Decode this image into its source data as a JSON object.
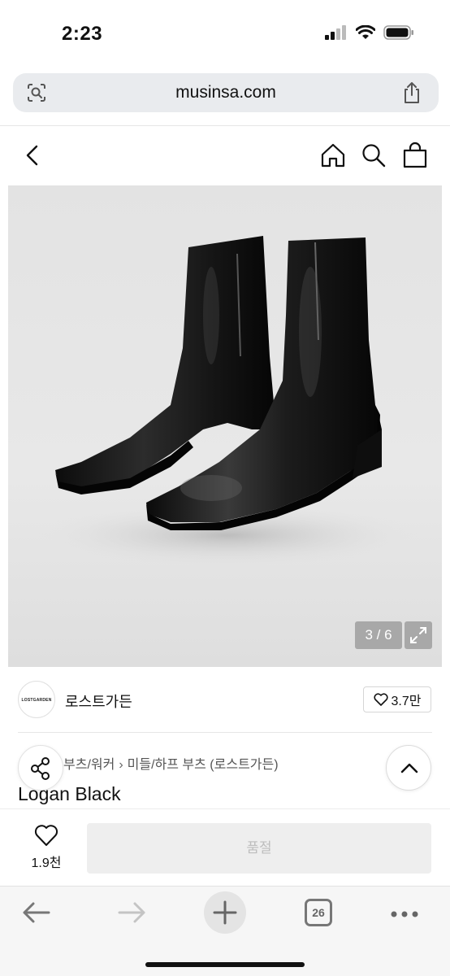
{
  "status_bar": {
    "time": "2:23"
  },
  "browser": {
    "url": "musinsa.com",
    "tab_count": "26"
  },
  "product": {
    "image_counter": "3 / 6",
    "brand": {
      "name": "로스트가든",
      "logo_text": "LOSTGARDEN",
      "likes": "3.7만"
    },
    "breadcrumb": [
      "부츠/워커",
      "미들/하프 부츠 (로스트가든)"
    ],
    "title": "Logan Black"
  },
  "purchase_bar": {
    "wish_count": "1.9천",
    "action_label": "품절"
  },
  "colors": {
    "background": "#ffffff",
    "url_bar": "#e9ebee",
    "image_bg": "#e5e5e5",
    "soldout_button": "#eeeeee",
    "soldout_text": "#bdbdbd",
    "toolbar": "#f6f6f6"
  },
  "icons": [
    "signal-icon",
    "wifi-icon",
    "battery-icon",
    "visual-search-icon",
    "share-icon",
    "back-chevron-icon",
    "home-icon",
    "search-icon",
    "shopping-bag-icon",
    "expand-icon",
    "heart-icon",
    "share-nodes-icon",
    "chevron-up-icon",
    "arrow-left-icon",
    "arrow-right-icon",
    "plus-icon",
    "tabs-icon",
    "more-dots-icon"
  ]
}
